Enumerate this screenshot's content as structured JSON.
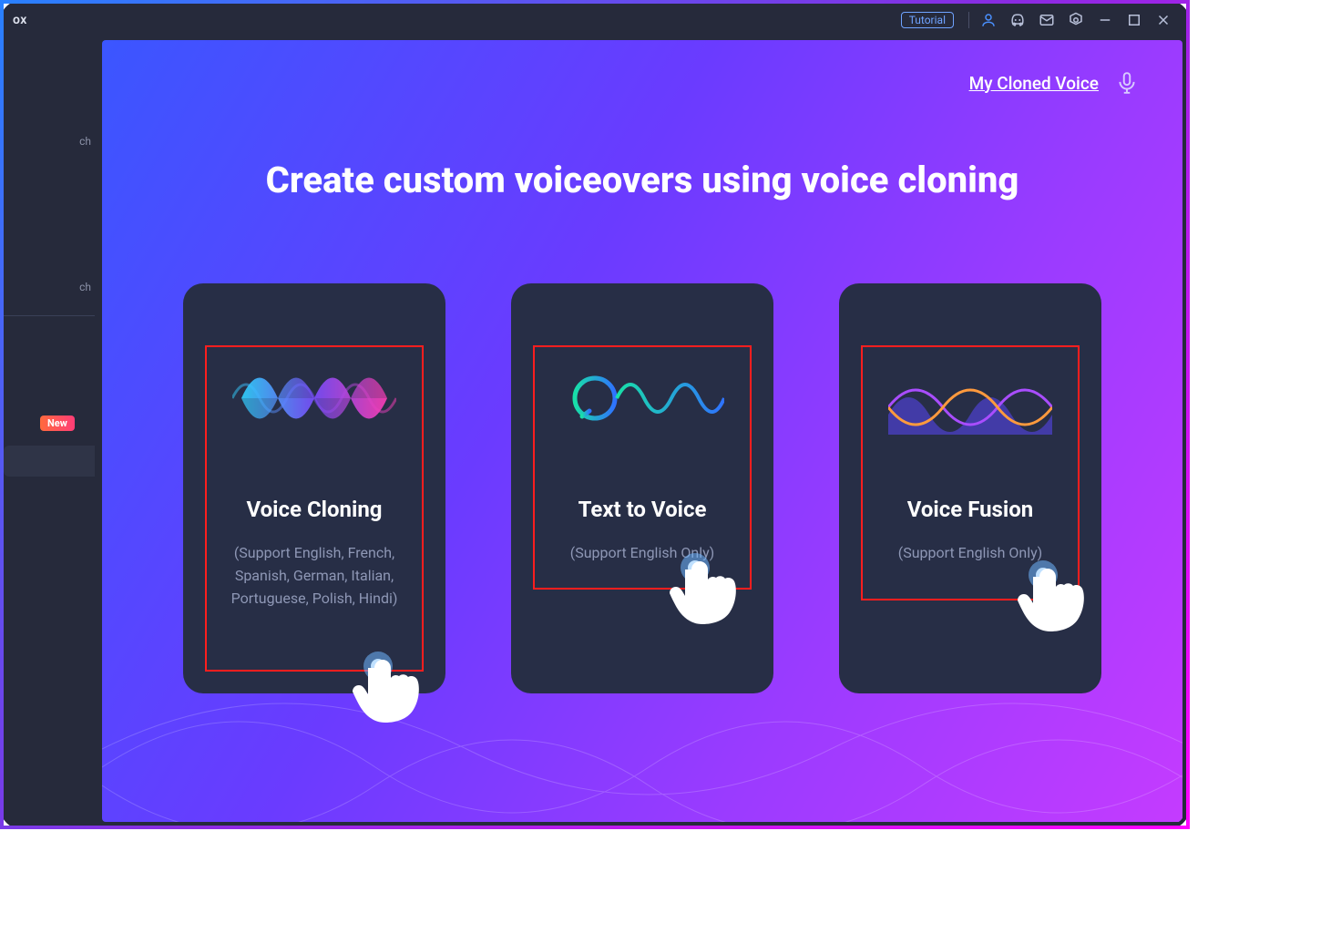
{
  "titlebar": {
    "app_fragment": "ox",
    "tutorial_label": "Tutorial"
  },
  "sidebar": {
    "items": [
      {
        "label": "ch"
      },
      {
        "label": "ch"
      }
    ],
    "new_badge": "New"
  },
  "main": {
    "cloned_link": "My Cloned Voice",
    "heading": "Create custom voiceovers using voice cloning",
    "cards": [
      {
        "title": "Voice Cloning",
        "sub": "(Support English, French, Spanish, German, Italian, Portuguese, Polish, Hindi)"
      },
      {
        "title": "Text to Voice",
        "sub": "(Support English Only)"
      },
      {
        "title": "Voice Fusion",
        "sub": "(Support English Only)"
      }
    ]
  }
}
